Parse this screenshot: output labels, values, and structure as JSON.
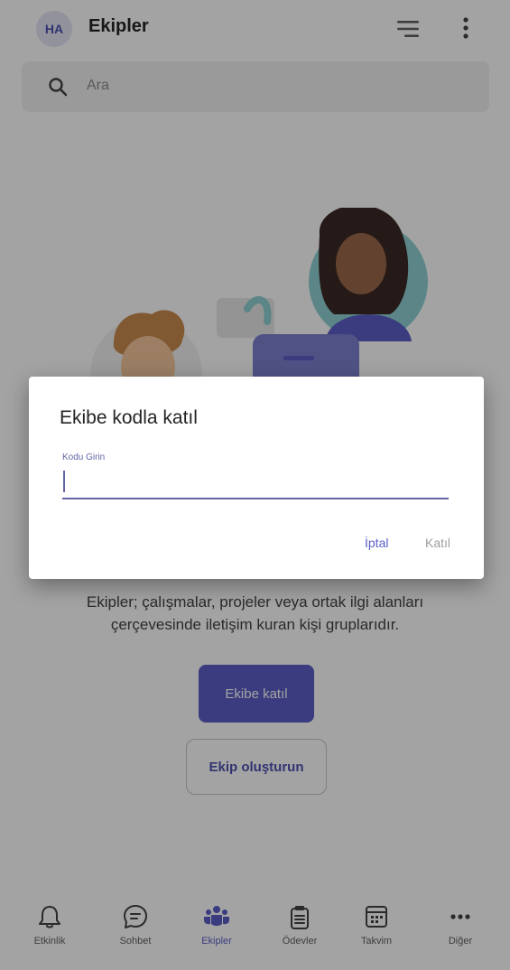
{
  "header": {
    "avatar_initials": "HA",
    "title": "Ekipler",
    "icons": [
      "filter-icon",
      "more-vertical-icon"
    ]
  },
  "search": {
    "placeholder": "Ara"
  },
  "empty_state": {
    "description": "Ekipler; çalışmalar, projeler veya ortak ilgi alanları çerçevesinde iletişim kuran kişi gruplarıdır.",
    "join_button": "Ekibe katıl",
    "create_button": "Ekip oluşturun"
  },
  "dialog": {
    "title": "Ekibe kodla katıl",
    "field_label": "Kodu Girin",
    "field_value": "",
    "cancel_label": "İptal",
    "join_label": "Katıl"
  },
  "bottom_nav": {
    "items": [
      {
        "label": "Etkinlik",
        "icon": "bell-icon"
      },
      {
        "label": "Sohbet",
        "icon": "chat-icon"
      },
      {
        "label": "Ekipler",
        "icon": "teams-icon",
        "active": true
      },
      {
        "label": "Ödevler",
        "icon": "assignments-icon"
      },
      {
        "label": "Takvim",
        "icon": "calendar-icon"
      },
      {
        "label": "Diğer",
        "icon": "more-horizontal-icon"
      }
    ]
  },
  "colors": {
    "brand": "#5b5fc7",
    "accent": "#6264a7",
    "scrim": "rgba(0,0,0,0.36)"
  }
}
